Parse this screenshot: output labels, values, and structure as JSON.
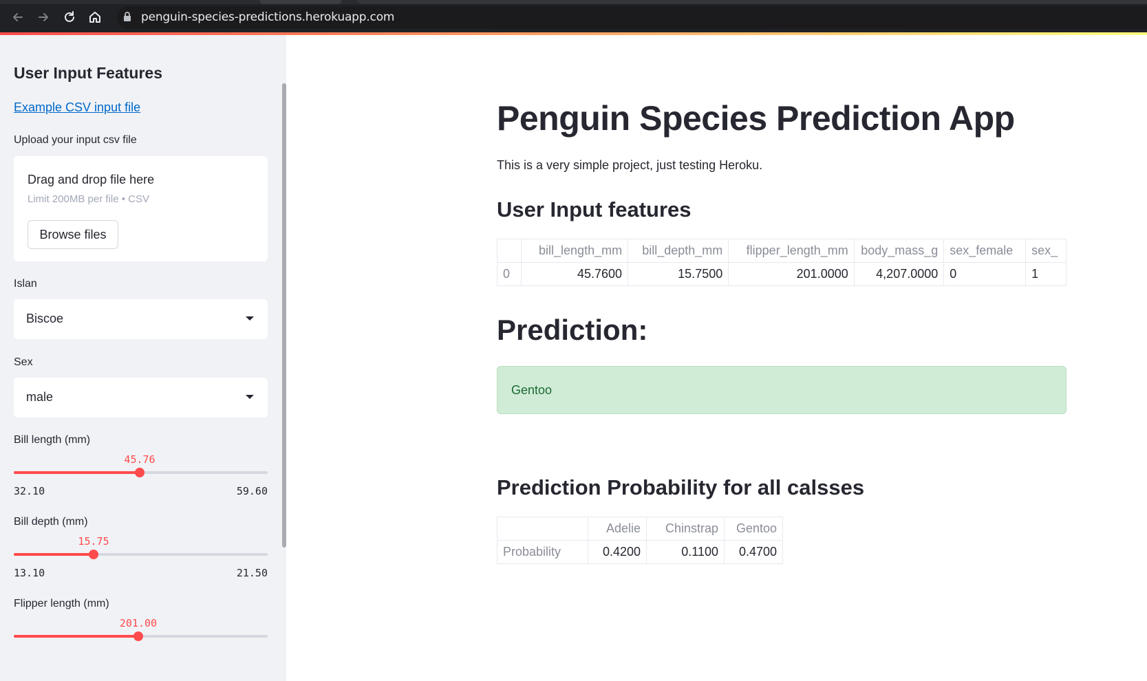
{
  "browser": {
    "url": "penguin-species-predictions.herokuapp.com"
  },
  "sidebar": {
    "title": "User Input Features",
    "example_link": "Example CSV input file",
    "upload_label": "Upload your input csv file",
    "uploader": {
      "drop_title": "Drag and drop file here",
      "limit_text": "Limit 200MB per file • CSV",
      "browse_label": "Browse files"
    },
    "island": {
      "label": "Islan",
      "value": "Biscoe"
    },
    "sex": {
      "label": "Sex",
      "value": "male"
    },
    "sliders": [
      {
        "label": "Bill length (mm)",
        "value": "45.76",
        "min": "32.10",
        "max": "59.60",
        "fraction": 0.4967
      },
      {
        "label": "Bill depth (mm)",
        "value": "15.75",
        "min": "13.10",
        "max": "21.50",
        "fraction": 0.3155
      },
      {
        "label": "Flipper length (mm)",
        "value": "201.00",
        "min": "",
        "max": "",
        "fraction": 0.49
      }
    ]
  },
  "main": {
    "title": "Penguin Species Prediction App",
    "description": "This is a very simple project, just testing Heroku.",
    "input_header": "User Input features",
    "input_table": {
      "columns": [
        "",
        "bill_length_mm",
        "bill_depth_mm",
        "flipper_length_mm",
        "body_mass_g",
        "sex_female",
        "sex_"
      ],
      "rows": [
        [
          "0",
          "45.7600",
          "15.7500",
          "201.0000",
          "4,207.0000",
          "0",
          "1"
        ]
      ]
    },
    "prediction_header": "Prediction:",
    "prediction_value": "Gentoo",
    "probability_header": "Prediction Probability for all calsses",
    "probability_table": {
      "columns": [
        "",
        "Adelie",
        "Chinstrap",
        "Gentoo"
      ],
      "rows": [
        [
          "Probability",
          "0.4200",
          "0.1100",
          "0.4700"
        ]
      ]
    }
  },
  "colors": {
    "accent": "#ff4b4b",
    "link": "#0068c9",
    "success_bg": "#d0ecd6",
    "success_text": "#1c6a34",
    "sidebar_bg": "#f0f2f6"
  }
}
